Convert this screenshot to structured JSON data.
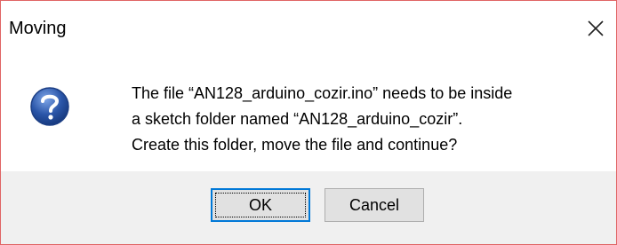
{
  "window": {
    "title": "Moving",
    "close_icon": "close-icon"
  },
  "message": {
    "icon": "question-icon",
    "lines": [
      "The file “AN128_arduino_cozir.ino” needs to be inside",
      "a sketch folder named “AN128_arduino_cozir”.",
      "Create this folder, move the file and continue?"
    ]
  },
  "buttons": {
    "ok_label": "OK",
    "cancel_label": "Cancel"
  },
  "colors": {
    "border": "#e06464",
    "icon_blue": "#2a55a8",
    "focus_blue": "#0078d7"
  }
}
